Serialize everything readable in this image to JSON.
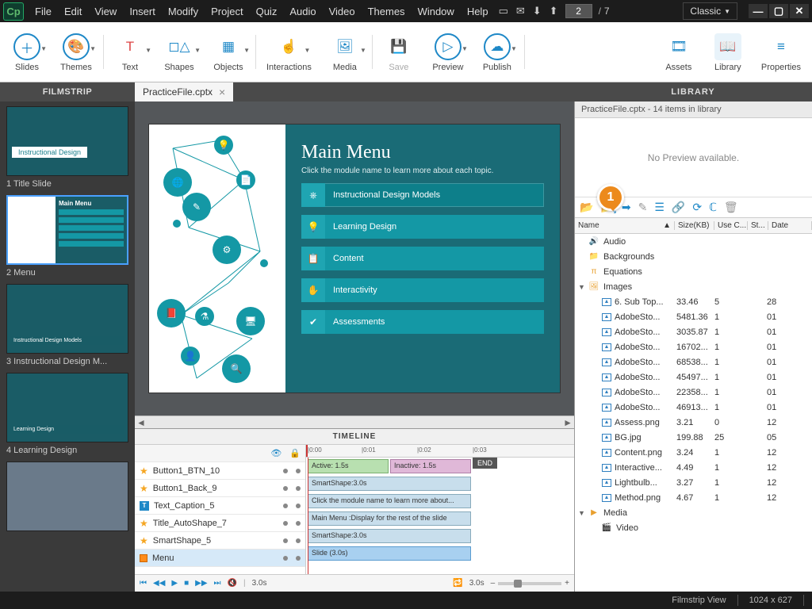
{
  "menu": {
    "items": [
      "File",
      "Edit",
      "View",
      "Insert",
      "Modify",
      "Project",
      "Quiz",
      "Audio",
      "Video",
      "Themes",
      "Window",
      "Help"
    ],
    "page_current": "2",
    "page_total": "7",
    "workspace": "Classic"
  },
  "ribbon": {
    "g1": [
      {
        "l": "Slides"
      },
      {
        "l": "Themes"
      }
    ],
    "g2": [
      {
        "l": "Text"
      },
      {
        "l": "Shapes"
      },
      {
        "l": "Objects"
      }
    ],
    "g3": [
      {
        "l": "Interactions"
      },
      {
        "l": "Media"
      }
    ],
    "g4": [
      {
        "l": "Save"
      },
      {
        "l": "Preview"
      },
      {
        "l": "Publish"
      }
    ],
    "g5": [
      {
        "l": "Assets"
      },
      {
        "l": "Library"
      },
      {
        "l": "Properties"
      }
    ]
  },
  "filetab": "PracticeFile.cptx",
  "panels": {
    "filmstrip": "FILMSTRIP",
    "library": "LIBRARY",
    "timeline": "TIMELINE"
  },
  "filmstrip": [
    {
      "cap": "1 Title Slide"
    },
    {
      "cap": "2 Menu"
    },
    {
      "cap": "3 Instructional Design M..."
    },
    {
      "cap": "4 Learning Design"
    }
  ],
  "slide": {
    "title": "Main Menu",
    "subtitle": "Click the module name to learn more about each topic.",
    "buttons": [
      "Instructional Design Models",
      "Learning Design",
      "Content",
      "Interactivity",
      "Assessments"
    ]
  },
  "timeline": {
    "rows": [
      {
        "t": "star",
        "n": "Button1_BTN_10"
      },
      {
        "t": "star",
        "n": "Button1_Back_9"
      },
      {
        "t": "T",
        "n": "Text_Caption_5"
      },
      {
        "t": "star",
        "n": "Title_AutoShape_7"
      },
      {
        "t": "star",
        "n": "SmartShape_5"
      },
      {
        "t": "sq",
        "n": "Menu"
      }
    ],
    "bars": {
      "active": "Active: 1.5s",
      "inactive": "Inactive: 1.5s",
      "end": "END",
      "b2": "SmartShape:3.0s",
      "b3": "Click the module name to learn more about...",
      "b4": "Main Menu :Display for the rest of the slide",
      "b5": "SmartShape:3.0s",
      "b6": "Slide (3.0s)"
    },
    "ticks": [
      "|0:00",
      "|0:01",
      "|0:02",
      "|0:03"
    ],
    "time": "3.0s"
  },
  "library": {
    "title": "PracticeFile.cptx - 14 items in library",
    "preview": "No Preview available.",
    "callout": "1",
    "cols": [
      "Name",
      "Size(KB)",
      "Use C...",
      "St...",
      "Date"
    ],
    "folders": [
      "Audio",
      "Backgrounds",
      "Equations",
      "Images",
      "Media",
      "Video"
    ],
    "images": [
      {
        "n": "6. Sub Top...",
        "s": "33.46",
        "u": "5",
        "d": "28"
      },
      {
        "n": "AdobeSto...",
        "s": "5481.36",
        "u": "1",
        "d": "01"
      },
      {
        "n": "AdobeSto...",
        "s": "3035.87",
        "u": "1",
        "d": "01"
      },
      {
        "n": "AdobeSto...",
        "s": "16702...",
        "u": "1",
        "d": "01"
      },
      {
        "n": "AdobeSto...",
        "s": "68538...",
        "u": "1",
        "d": "01"
      },
      {
        "n": "AdobeSto...",
        "s": "45497...",
        "u": "1",
        "d": "01"
      },
      {
        "n": "AdobeSto...",
        "s": "22358...",
        "u": "1",
        "d": "01"
      },
      {
        "n": "AdobeSto...",
        "s": "46913...",
        "u": "1",
        "d": "01"
      },
      {
        "n": "Assess.png",
        "s": "3.21",
        "u": "0",
        "d": "12"
      },
      {
        "n": "BG.jpg",
        "s": "199.88",
        "u": "25",
        "d": "05"
      },
      {
        "n": "Content.png",
        "s": "3.24",
        "u": "1",
        "d": "12"
      },
      {
        "n": "Interactive...",
        "s": "4.49",
        "u": "1",
        "d": "12"
      },
      {
        "n": "Lightbulb...",
        "s": "3.27",
        "u": "1",
        "d": "12"
      },
      {
        "n": "Method.png",
        "s": "4.67",
        "u": "1",
        "d": "12"
      }
    ]
  },
  "status": {
    "view": "Filmstrip View",
    "dims": "1024 x 627"
  }
}
